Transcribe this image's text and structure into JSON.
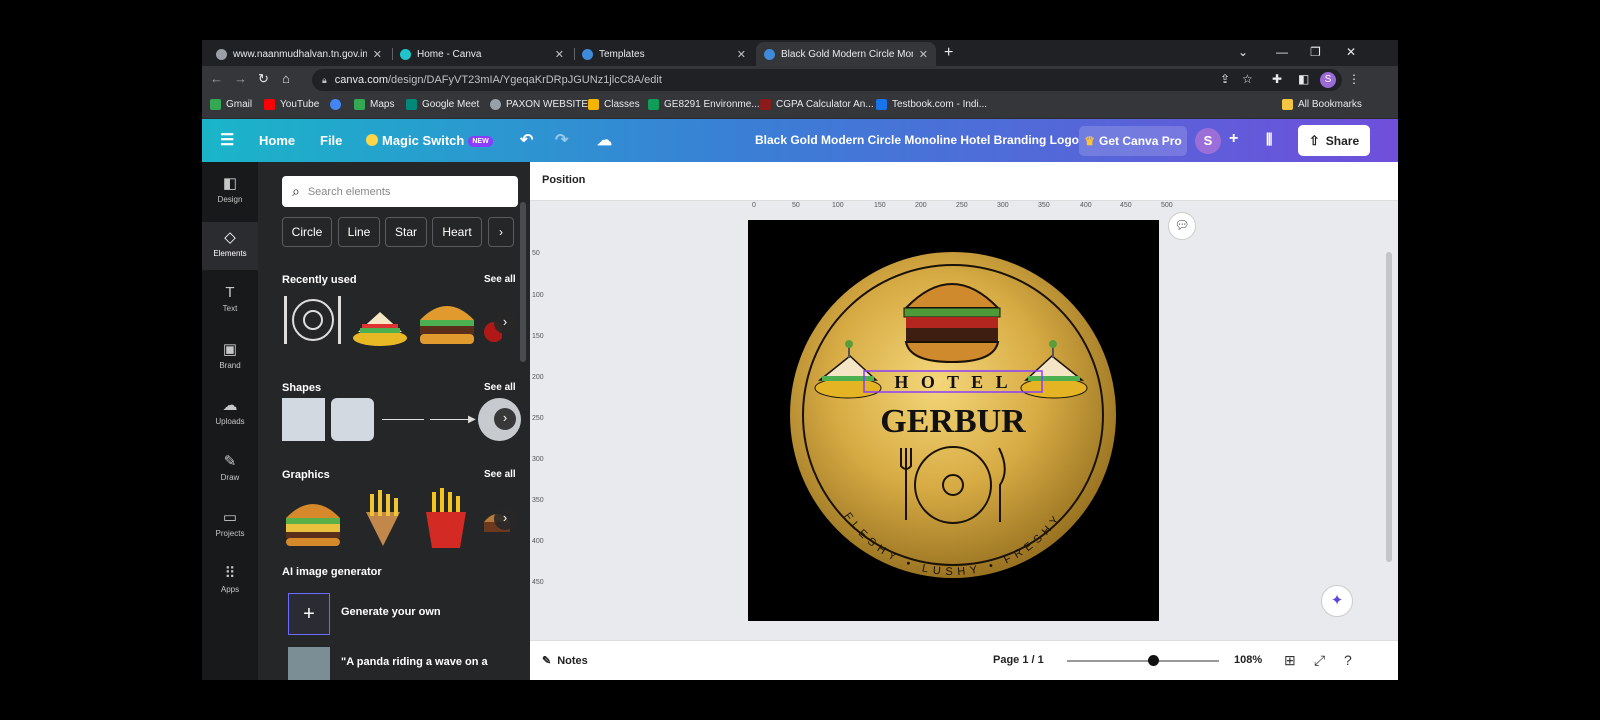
{
  "browser": {
    "tabs": [
      {
        "title": "www.naanmudhalvan.tn.gov.in",
        "color": "#9aa0a6"
      },
      {
        "title": "Home - Canva",
        "color": "#20c4cb"
      },
      {
        "title": "Templates",
        "color": "#3d8bd9"
      },
      {
        "title": "Black Gold Modern Circle Mono",
        "color": "#3d8bd9"
      }
    ],
    "url_domain": "canva.com",
    "url_path": "/design/DAFyVT23mIA/YgeqaKrDRpJGUNz1jlcC8A/edit",
    "bookmarks": [
      {
        "label": "Gmail",
        "color": "#34a853"
      },
      {
        "label": "YouTube",
        "color": "#ff0000"
      },
      {
        "label": "",
        "color": "#4285f4"
      },
      {
        "label": "Maps",
        "color": "#34a853"
      },
      {
        "label": "Google Meet",
        "color": "#00897b"
      },
      {
        "label": "PAXON WEBSITE",
        "color": "#9aa0a6"
      },
      {
        "label": "Classes",
        "color": "#f4b400"
      },
      {
        "label": "GE8291 Environme...",
        "color": "#0f9d58"
      },
      {
        "label": "CGPA Calculator An...",
        "color": "#8b1a1a"
      },
      {
        "label": "Testbook.com - Indi...",
        "color": "#1a73e8"
      }
    ],
    "all_bookmarks": "All Bookmarks",
    "profile_initial": "S"
  },
  "header": {
    "home": "Home",
    "file": "File",
    "magic_switch": "Magic Switch",
    "new_badge": "NEW",
    "doc_title": "Black Gold Modern Circle Monoline Hotel Branding Logo",
    "get_pro": "Get Canva Pro",
    "avatar": "S",
    "share": "Share"
  },
  "rail": [
    {
      "icon": "◧",
      "label": "Design"
    },
    {
      "icon": "◇",
      "label": "Elements"
    },
    {
      "icon": "T",
      "label": "Text"
    },
    {
      "icon": "▣",
      "label": "Brand"
    },
    {
      "icon": "☁",
      "label": "Uploads"
    },
    {
      "icon": "✎",
      "label": "Draw"
    },
    {
      "icon": "▭",
      "label": "Projects"
    },
    {
      "icon": "⠿",
      "label": "Apps"
    }
  ],
  "panel": {
    "search_placeholder": "Search elements",
    "chips": [
      "Circle",
      "Line",
      "Star",
      "Heart"
    ],
    "recently_used": "Recently used",
    "shapes": "Shapes",
    "graphics": "Graphics",
    "see_all": "See all",
    "ai_generator": "AI image generator",
    "generate": "Generate your own",
    "panda": "\"A panda riding a wave on a"
  },
  "canvas": {
    "position": "Position",
    "ruler_h": [
      "0",
      "50",
      "100",
      "150",
      "200",
      "250",
      "300",
      "350",
      "400",
      "450",
      "500"
    ],
    "ruler_v": [
      "50",
      "100",
      "150",
      "200",
      "250",
      "300",
      "350",
      "400",
      "450"
    ],
    "logo": {
      "hotel": "H O T E L",
      "brand": "GERBUR",
      "tagline": "FLESHY • LUSHY • FRESHY"
    }
  },
  "footer": {
    "notes": "Notes",
    "page": "Page 1 / 1",
    "zoom": "108%",
    "zoom_fraction": 0.57
  }
}
